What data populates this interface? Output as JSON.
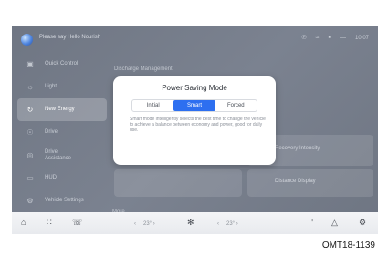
{
  "status_bar": {
    "voice_hint": "Please say Hello Nourish",
    "icons": [
      "bluetooth-icon",
      "wifi-icon",
      "signal-icon",
      "battery-icon"
    ],
    "time": "10:07"
  },
  "sidebar": {
    "items": [
      {
        "label": "Quick Control",
        "icon": "car-icon"
      },
      {
        "label": "Light",
        "icon": "light-icon"
      },
      {
        "label": "New Energy",
        "icon": "energy-icon",
        "active": true
      },
      {
        "label": "Drive",
        "icon": "steering-icon"
      },
      {
        "label": "Drive Assistance",
        "icon": "assist-icon"
      },
      {
        "label": "HUD",
        "icon": "hud-icon"
      },
      {
        "label": "Vehicle Settings",
        "icon": "settings-icon"
      }
    ]
  },
  "content": {
    "section_title": "Discharge Management",
    "card1": "Recovery Intensity",
    "card2": "Distance Display",
    "more_label": "More"
  },
  "modal": {
    "title": "Power Saving Mode",
    "options": [
      "Initial",
      "Smart",
      "Forced"
    ],
    "selected": "Smart",
    "description": "Smart mode intelligently selects the best time to change the vehicle to achieve a balance between economy and power, good for daily use."
  },
  "bottom_bar": {
    "left_temp": "23° ›",
    "right_temp": "23° ›",
    "left_arrow": "‹",
    "right_arrow": "‹"
  },
  "caption": "OMT18-1139"
}
